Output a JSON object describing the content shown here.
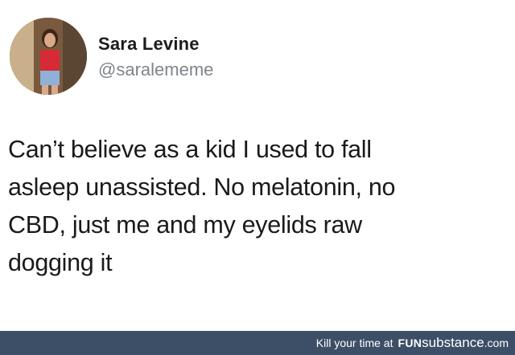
{
  "tweet": {
    "display_name": "Sara Levine",
    "handle": "@saralememe",
    "lines": [
      "Can’t believe as a kid I used to fall",
      "asleep unassisted. No melatonin, no",
      "CBD, just me and my eyelids raw",
      "dogging it"
    ]
  },
  "footer": {
    "tagline": "Kill your time at",
    "brand_fun": "FUN",
    "brand_rest": "substance",
    "brand_tld": ".com"
  },
  "colors": {
    "footer_bg": "#3d4f66",
    "handle": "#7d858c",
    "text": "#1a1a1a"
  }
}
